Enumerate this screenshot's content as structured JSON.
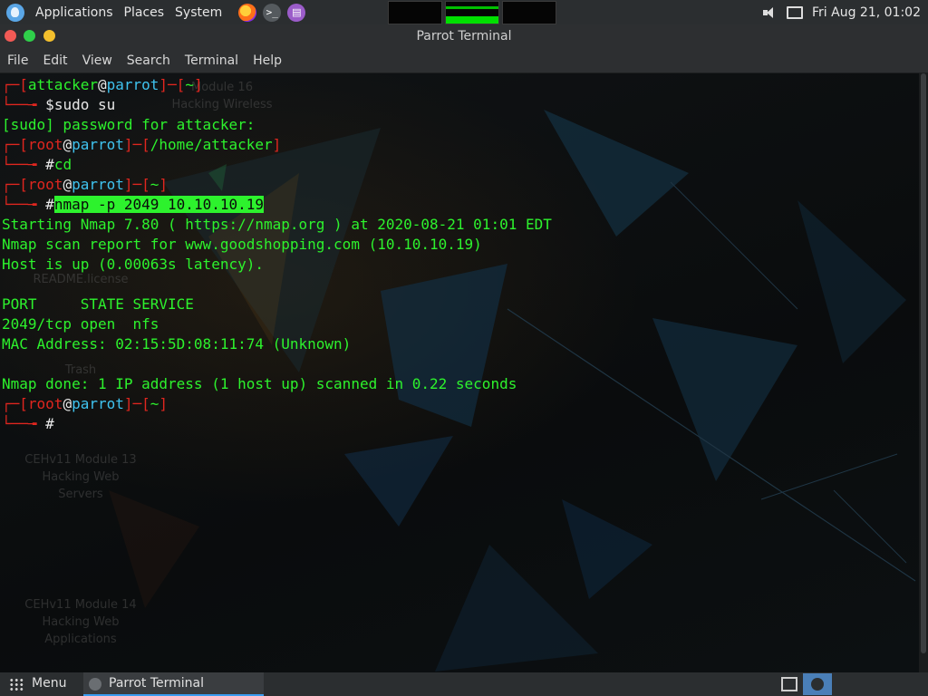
{
  "top_panel": {
    "menus": [
      "Applications",
      "Places",
      "System"
    ],
    "clock": "Fri Aug 21, 01:02",
    "launchers": [
      "firefox-icon",
      "terminal-icon",
      "text-editor-icon"
    ]
  },
  "window": {
    "title": "Parrot Terminal",
    "menu": [
      "File",
      "Edit",
      "View",
      "Search",
      "Terminal",
      "Help"
    ]
  },
  "desktop_icons": [
    "Module 16\nHacking Wireless",
    "README.license",
    "Trash",
    "CEHv11 Module 13\nHacking Web\nServers",
    "CEHv11 Module 14\nHacking Web\nApplications"
  ],
  "terminal": {
    "prompt1": {
      "user": "attacker",
      "at": "@",
      "host": "parrot",
      "dir": "~",
      "sign": "$",
      "cmd": "sudo su"
    },
    "sudo_line": "[sudo] password for attacker:",
    "prompt2": {
      "user": "root",
      "at": "@",
      "host": "parrot",
      "dir": "/home/attacker",
      "sign": "#",
      "cmd": "cd"
    },
    "prompt3": {
      "user": "root",
      "at": "@",
      "host": "parrot",
      "dir": "~",
      "sign": "#",
      "cmd": "nmap -p 2049 10.10.10.19"
    },
    "output": [
      "Starting Nmap 7.80 ( https://nmap.org ) at 2020-08-21 01:01 EDT",
      "Nmap scan report for www.goodshopping.com (10.10.10.19)",
      "Host is up (0.00063s latency).",
      "",
      "PORT     STATE SERVICE",
      "2049/tcp open  nfs",
      "MAC Address: 02:15:5D:08:11:74 (Unknown)",
      "",
      "Nmap done: 1 IP address (1 host up) scanned in 0.22 seconds"
    ],
    "prompt4": {
      "user": "root",
      "at": "@",
      "host": "parrot",
      "dir": "~",
      "sign": "#"
    }
  },
  "bottom_panel": {
    "menu_label": "Menu",
    "task_label": "Parrot Terminal"
  }
}
